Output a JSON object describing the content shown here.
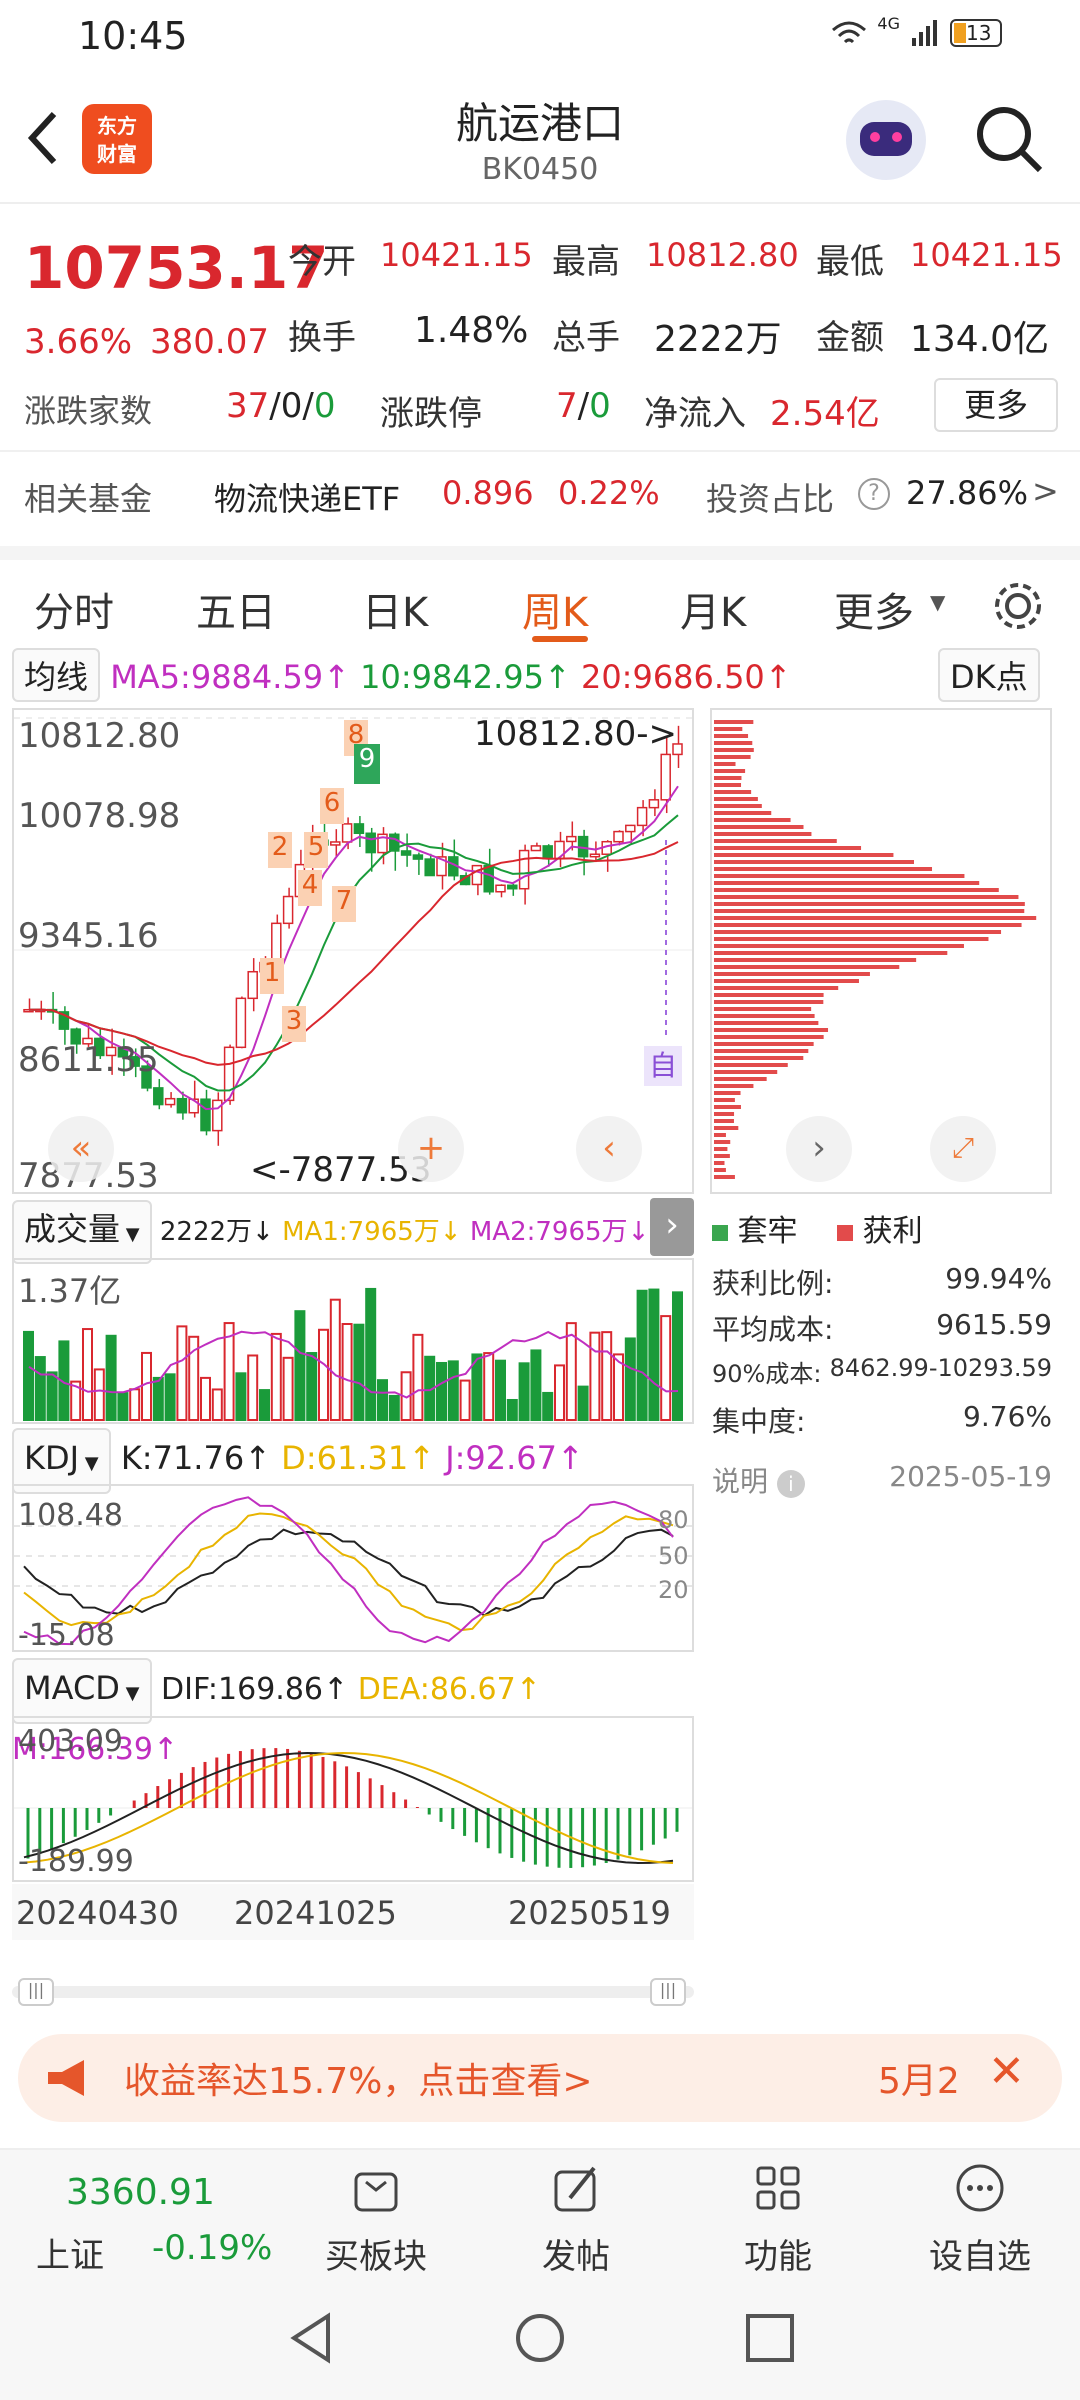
{
  "status": {
    "time": "10:45",
    "battery": "13",
    "network": "4G"
  },
  "nav": {
    "title": "航运港口",
    "code": "BK0450",
    "logo_line1": "东方",
    "logo_line2": "财富"
  },
  "quote": {
    "price": "10753.17",
    "change_pct": "3.66%",
    "change": "380.07",
    "open_label": "今开",
    "open": "10421.15",
    "high_label": "最高",
    "high": "10812.80",
    "low_label": "最低",
    "low": "10421.15",
    "turnover_label": "换手",
    "turnover": "1.48%",
    "volume_label": "总手",
    "volume": "2222万",
    "amount_label": "金额",
    "amount": "134.0亿",
    "updown_label": "涨跌家数",
    "up": "37",
    "sep1": "/",
    "flat": "0",
    "sep2": "/",
    "down": "0",
    "limit_label": "涨跌停",
    "limit_up": "7",
    "sep3": "/",
    "limit_down": "0",
    "inflow_label": "净流入",
    "inflow": "2.54亿",
    "more_button": "更多"
  },
  "fund": {
    "label": "相关基金",
    "name": "物流快递ETF",
    "price": "0.896",
    "pct": "0.22%",
    "ratio_label": "投资占比",
    "ratio": "27.86%"
  },
  "tabs": [
    {
      "label": "分时"
    },
    {
      "label": "五日"
    },
    {
      "label": "日K"
    },
    {
      "label": "周K"
    },
    {
      "label": "月K"
    },
    {
      "label": "更多"
    }
  ],
  "ma": {
    "selector": "均线",
    "ma5": "MA5:9884.59",
    "ma10": "10:9842.95",
    "ma20": "20:9686.50",
    "dk": "DK点"
  },
  "main_chart": {
    "axis": [
      "10812.80",
      "10078.98",
      "9345.16",
      "8611.35",
      "7877.53"
    ],
    "max_label": "10812.80->",
    "min_label": "<-7877.53",
    "auto_label": "自",
    "marker_labels": [
      "8",
      "9",
      "6",
      "2",
      "5",
      "4",
      "7",
      "1",
      "3"
    ]
  },
  "volume": {
    "selector": "成交量",
    "vol": "2222万",
    "ma1": "MA1:7965万",
    "ma2": "MA2:7965万",
    "axis_top": "1.37亿"
  },
  "kdj": {
    "selector": "KDJ",
    "k": "K:71.76",
    "d": "D:61.31",
    "j": "J:92.67",
    "top": "108.48",
    "bottom": "-15.08",
    "l80": "80",
    "l50": "50",
    "l20": "20"
  },
  "macd": {
    "selector": "MACD",
    "dif": "DIF:169.86",
    "dea": "DEA:86.67",
    "m": "M:166.39",
    "top": "403.09",
    "bottom": "-189.99"
  },
  "dates": [
    "20240430",
    "20241025",
    "20250519"
  ],
  "chip": {
    "legend_trapped": "套牢",
    "legend_profit": "获利",
    "rows": [
      {
        "label": "获利比例:",
        "value": "99.94%"
      },
      {
        "label": "平均成本:",
        "value": "9615.59"
      },
      {
        "label": "90%成本:",
        "value": "8462.99-10293.59"
      },
      {
        "label": "集中度:",
        "value": "9.76%"
      }
    ],
    "explain": "说明",
    "date": "2025-05-19"
  },
  "banner": {
    "text": "收益率达15.7%，点击查看>",
    "date": "5月2"
  },
  "bottom": {
    "index_value": "3360.91",
    "index_name": "上证",
    "index_pct": "-0.19%",
    "items": [
      {
        "label": "买板块"
      },
      {
        "label": "发帖"
      },
      {
        "label": "功能"
      },
      {
        "label": "设自选"
      }
    ]
  },
  "colors": {
    "up": "#d9272e",
    "down": "#1a9b3a",
    "accent": "#e35b1a",
    "ma10": "#1a9b3a",
    "ma5": "#c02fc0",
    "d": "#e8b400"
  }
}
